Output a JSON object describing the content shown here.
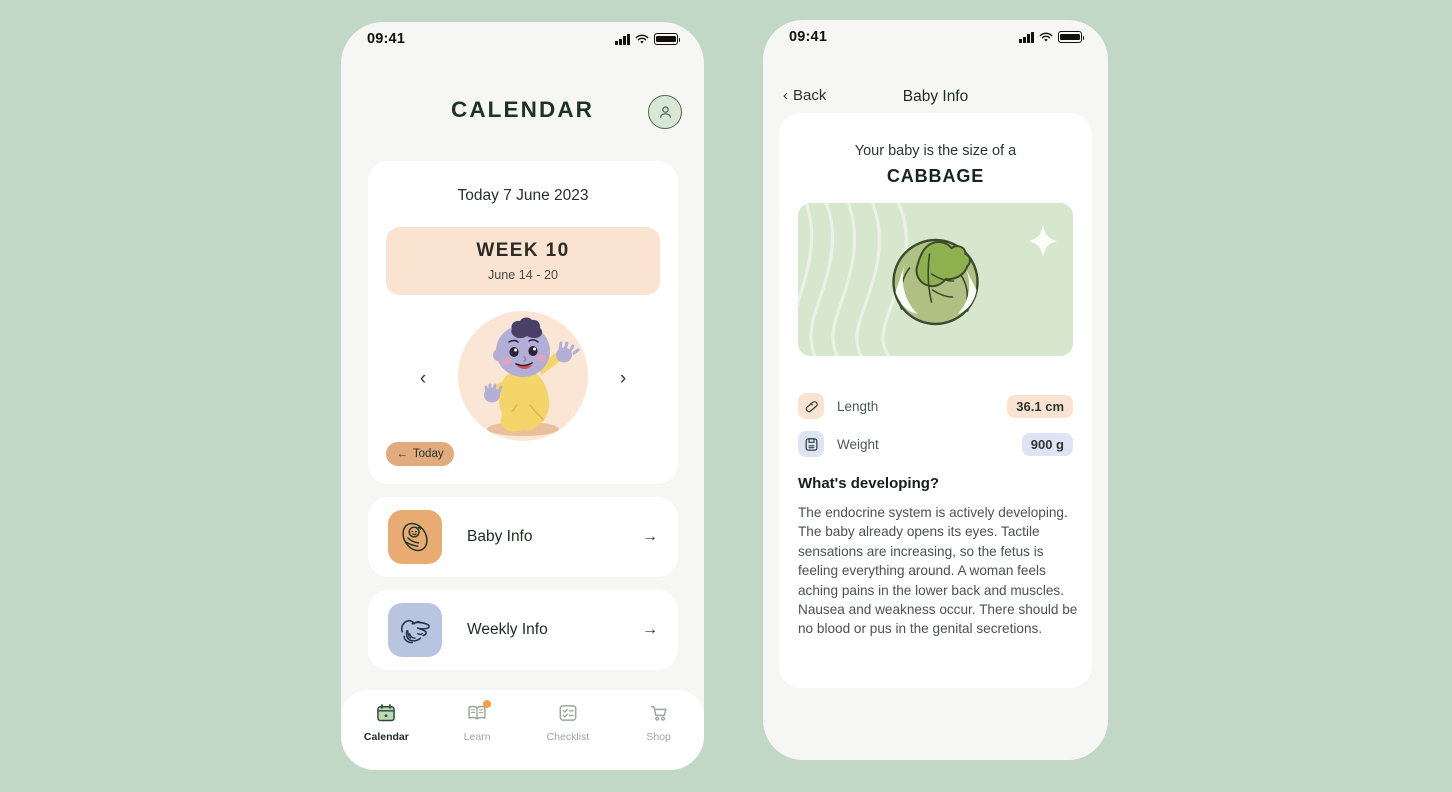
{
  "theme": {
    "page_background": "#c2d8c6",
    "card_background": "#ffffff",
    "accent_green": "#4c6b50",
    "accent_peach": "#fae3d0",
    "accent_tan": "#e2ab7d",
    "accent_lavender": "#b9c4e0",
    "panel_green": "#d7e7ce",
    "badge_orange": "#f2a14b"
  },
  "calendar_screen": {
    "status_bar": {
      "time": "09:41",
      "signal_icon": "signal-bars-icon",
      "wifi_icon": "wifi-icon",
      "battery_icon": "battery-icon"
    },
    "header": {
      "title": "CALENDAR",
      "avatar_icon": "person-icon"
    },
    "today_card": {
      "today_label": "Today 7 June 2023",
      "week_title": "WEEK  10",
      "week_range": "June 14 - 20",
      "prev_icon": "chevron-left-icon",
      "next_icon": "chevron-right-icon",
      "baby_illustration": "baby-sitting-illustration",
      "today_pill": {
        "arrow_icon": "arrow-left-icon",
        "label": "Today"
      }
    },
    "menu_items": [
      {
        "label": "Baby Info",
        "icon": "swaddled-baby-icon",
        "tile_color": "#e8ac72",
        "arrow_icon": "arrow-right-icon"
      },
      {
        "label": "Weekly Info",
        "icon": "hand-holding-baby-hand-icon",
        "tile_color": "#b9c4e0",
        "arrow_icon": "arrow-right-icon"
      }
    ],
    "tab_bar": [
      {
        "label": "Calendar",
        "icon": "calendar-icon",
        "active": true,
        "badge": false
      },
      {
        "label": "Learn",
        "icon": "open-book-icon",
        "active": false,
        "badge": true
      },
      {
        "label": "Checklist",
        "icon": "checklist-icon",
        "active": false,
        "badge": false
      },
      {
        "label": "Shop",
        "icon": "shopping-cart-icon",
        "active": false,
        "badge": false
      }
    ]
  },
  "baby_info_screen": {
    "status_bar": {
      "time": "09:41",
      "signal_icon": "signal-bars-icon",
      "wifi_icon": "wifi-icon",
      "battery_icon": "battery-icon"
    },
    "nav": {
      "back_label": "Back",
      "back_icon": "chevron-left-icon",
      "title": "Baby Info"
    },
    "size": {
      "intro": "Your baby is the size of a",
      "name": "CABBAGE",
      "illustration": "cabbage-illustration",
      "sparkle_icon": "sparkle-icon"
    },
    "stats": [
      {
        "name": "Length",
        "value": "36.1 cm",
        "icon": "ruler-icon",
        "icon_bg": "#fae3d0",
        "value_bg": "#fae3d0"
      },
      {
        "name": "Weight",
        "value": "900 g",
        "icon": "scale-icon",
        "icon_bg": "#dfe4f4",
        "value_bg": "#dfe4f4"
      }
    ],
    "developing": {
      "heading": "What's developing?",
      "body": "The endocrine system is actively developing. The baby already opens its eyes. Tactile sensations are increasing, so the fetus is feeling everything around. A woman feels aching pains in the lower back and muscles. Nausea and weakness occur. There should be no blood or pus in the genital secretions."
    }
  }
}
